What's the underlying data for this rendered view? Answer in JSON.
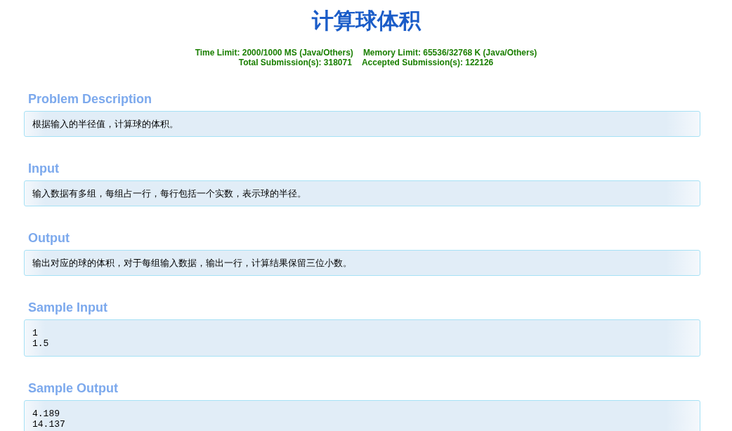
{
  "title": "计算球体积",
  "limits": [
    {
      "items": [
        "Time Limit: 2000/1000 MS (Java/Others)",
        "Memory Limit: 65536/32768 K (Java/Others)"
      ]
    },
    {
      "items": [
        "Total Submission(s): 318071",
        "Accepted Submission(s): 122126"
      ]
    }
  ],
  "sections": [
    {
      "heading": "Problem Description",
      "kind": "text",
      "lines": [
        "根据输入的半径值，计算球的体积。"
      ]
    },
    {
      "heading": "Input",
      "kind": "text",
      "lines": [
        "输入数据有多组，每组占一行，每行包括一个实数，表示球的半径。"
      ]
    },
    {
      "heading": "Output",
      "kind": "text",
      "lines": [
        "输出对应的球的体积，对于每组输入数据，输出一行，计算结果保留三位小数。"
      ]
    },
    {
      "heading": "Sample Input",
      "kind": "code",
      "lines": [
        "1",
        "1.5"
      ]
    },
    {
      "heading": "Sample Output",
      "kind": "code",
      "lines": [
        "4.189",
        "14.137"
      ]
    }
  ]
}
